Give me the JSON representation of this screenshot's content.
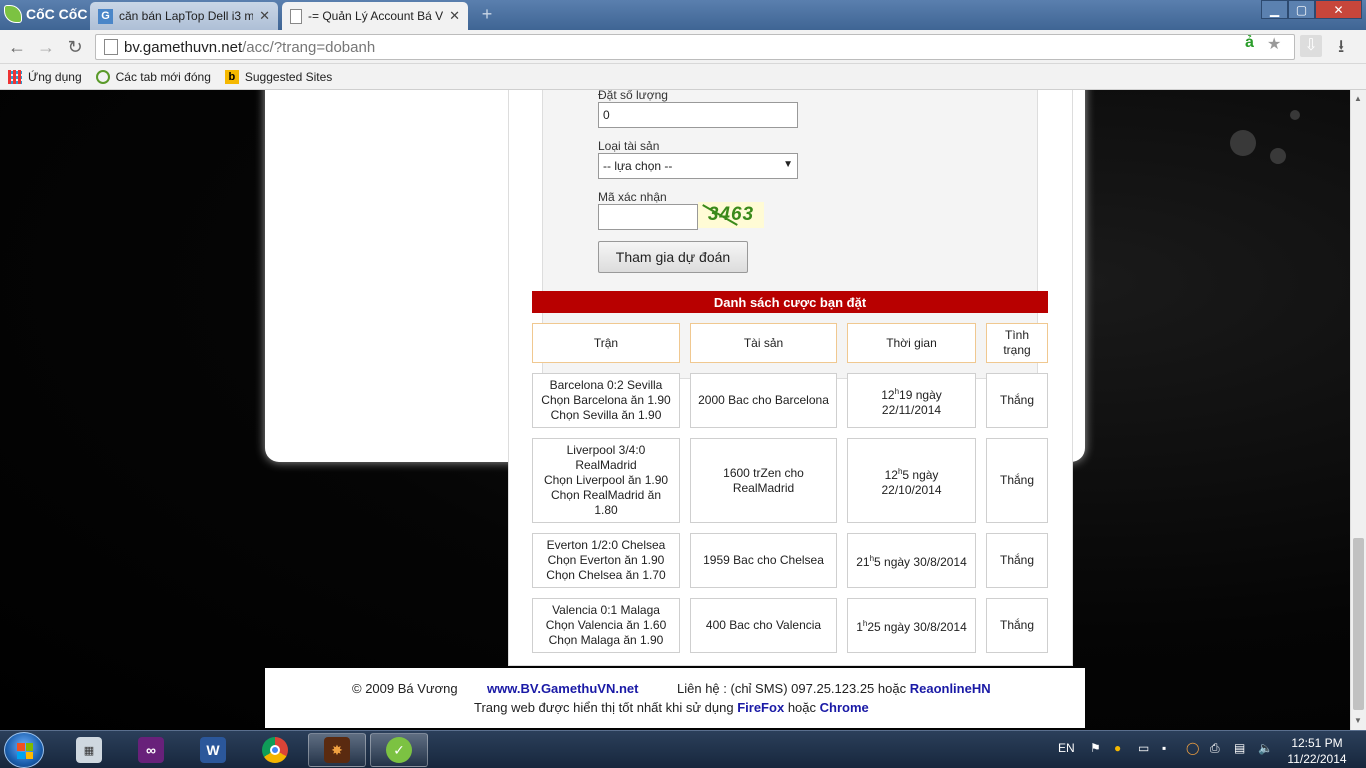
{
  "browser": {
    "brand": "CốC CốC",
    "tabs": [
      {
        "title": "căn bán LapTop Dell i3 m",
        "active": false,
        "favicon": "google-g-icon"
      },
      {
        "title": "-= Quản Lý Account Bá Vư",
        "active": true,
        "favicon": "page-icon"
      }
    ],
    "url_host": "bv.gamethuvn.net",
    "url_path": "/acc/?trang=dobanh",
    "bookmarks": [
      {
        "label": "Ứng dụng",
        "icon": "apps-grid-icon"
      },
      {
        "label": "Các tab mới đóng",
        "icon": "recent-tabs-icon"
      },
      {
        "label": "Suggested Sites",
        "icon": "bing-icon"
      }
    ]
  },
  "form": {
    "quantity_label": "Đặt số lượng",
    "quantity_value": "0",
    "asset_label": "Loại tài sản",
    "asset_selected": "-- lựa chọn --",
    "captcha_label": "Mã xác nhận",
    "captcha_value": "",
    "captcha_text": "3463",
    "submit_label": "Tham gia dự đoán"
  },
  "bets": {
    "title": "Danh sách cược bạn đặt",
    "headers": {
      "match": "Trận",
      "asset": "Tài sản",
      "time": "Thời gian",
      "status": "Tình trạng"
    },
    "rows": [
      {
        "match": [
          "Barcelona 0:2 Sevilla",
          "Chọn Barcelona ăn 1.90",
          "Chọn Sevilla ăn 1.90"
        ],
        "asset": "2000 Bac cho Barcelona",
        "time_hour": "12",
        "time_sup": "h",
        "time_rest": "19 ngày",
        "time_date": "22/11/2014",
        "status": "Thắng"
      },
      {
        "match": [
          "Liverpool 3/4:0",
          "RealMadrid",
          "Chọn Liverpool ăn 1.90",
          "Chọn RealMadrid ăn",
          "1.80"
        ],
        "asset": "1600 trZen cho RealMadrid",
        "time_hour": "12",
        "time_sup": "h",
        "time_rest": "5 ngày",
        "time_date": "22/10/2014",
        "status": "Thắng"
      },
      {
        "match": [
          "Everton 1/2:0 Chelsea",
          "Chọn Everton ăn 1.90",
          "Chọn Chelsea ăn 1.70"
        ],
        "asset": "1959 Bac cho Chelsea",
        "time_hour": "21",
        "time_sup": "h",
        "time_rest": "5 ngày 30/8/2014",
        "time_date": "",
        "status": "Thắng"
      },
      {
        "match": [
          "Valencia 0:1 Malaga",
          "Chọn Valencia ăn 1.60",
          "Chọn Malaga ăn 1.90"
        ],
        "asset": "400 Bac cho Valencia",
        "time_hour": "1",
        "time_sup": "h",
        "time_rest": "25 ngày 30/8/2014",
        "time_date": "",
        "status": "Thắng"
      }
    ]
  },
  "footer": {
    "copyright": "© 2009 Bá Vương",
    "site": "www.BV.GamethuVN.net",
    "contact": "Liên hệ : (chỉ SMS) 097.25.123.25 hoặc",
    "contact_link": "ReaonlineHN",
    "note_prefix": "Trang web được hiển thị tốt nhất khi sử dụng",
    "firefox": "FireFox",
    "or": "hoặc",
    "chrome": "Chrome"
  },
  "taskbar": {
    "language": "EN",
    "time": "12:51 PM",
    "date": "11/22/2014"
  }
}
